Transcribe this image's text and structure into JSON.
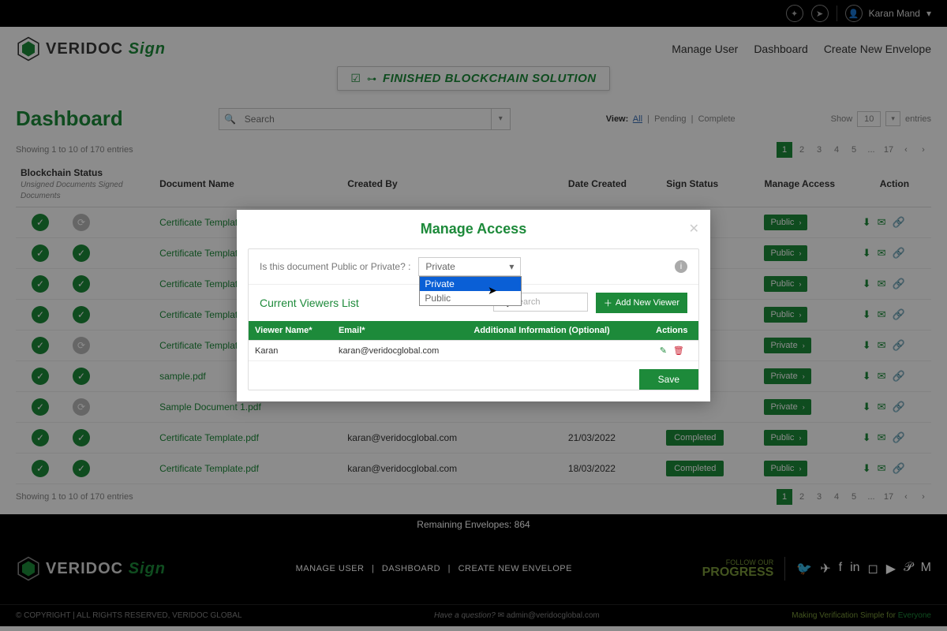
{
  "topbar": {
    "user_name": "Karan Mand"
  },
  "logo": {
    "brand": "VERIDOC",
    "product": "Sign"
  },
  "nav": {
    "manage_user": "Manage User",
    "dashboard": "Dashboard",
    "create_envelope": "Create New Envelope"
  },
  "banner": {
    "text": "FINISHED BLOCKCHAIN SOLUTION"
  },
  "dashboard": {
    "title": "Dashboard",
    "search_placeholder": "Search",
    "view_label": "View:",
    "view_all": "All",
    "view_pending": "Pending",
    "view_complete": "Complete",
    "show_label": "Show",
    "show_value": "10",
    "entries_label": "entries",
    "showing_text": "Showing 1 to 10 of 170 entries"
  },
  "pagination": {
    "pages": [
      "1",
      "2",
      "3",
      "4",
      "5",
      "...",
      "17"
    ]
  },
  "table": {
    "headers": {
      "blockchain": "Blockchain Status",
      "blockchain_sub": "Unsigned Documents Signed Documents",
      "doc": "Document Name",
      "createdby": "Created By",
      "datecreated": "Date Created",
      "signstatus": "Sign Status",
      "manageaccess": "Manage Access",
      "action": "Action"
    },
    "rows": [
      {
        "unsigned": "green",
        "signed": "gray",
        "doc": "Certificate Template.pdf",
        "by": "",
        "date": "",
        "status": "",
        "access": "Public"
      },
      {
        "unsigned": "green",
        "signed": "green",
        "doc": "Certificate Template.pdf",
        "by": "",
        "date": "",
        "status": "",
        "access": "Public"
      },
      {
        "unsigned": "green",
        "signed": "green",
        "doc": "Certificate Template.pdf",
        "by": "",
        "date": "",
        "status": "",
        "access": "Public"
      },
      {
        "unsigned": "green",
        "signed": "green",
        "doc": "Certificate Template.pdf",
        "by": "",
        "date": "",
        "status": "",
        "access": "Public"
      },
      {
        "unsigned": "green",
        "signed": "gray",
        "doc": "Certificate Template.pdf",
        "by": "",
        "date": "",
        "status": "",
        "access": "Private"
      },
      {
        "unsigned": "green",
        "signed": "green",
        "doc": "sample.pdf",
        "by": "",
        "date": "",
        "status": "",
        "access": "Private"
      },
      {
        "unsigned": "green",
        "signed": "gray",
        "doc": "Sample Document 1.pdf",
        "by": "",
        "date": "",
        "status": "",
        "access": "Private"
      },
      {
        "unsigned": "green",
        "signed": "green",
        "doc": "Certificate Template.pdf",
        "by": "karan@veridocglobal.com",
        "date": "21/03/2022",
        "status": "Completed",
        "access": "Public"
      },
      {
        "unsigned": "green",
        "signed": "green",
        "doc": "Certificate Template.pdf",
        "by": "karan@veridocglobal.com",
        "date": "18/03/2022",
        "status": "Completed",
        "access": "Public"
      }
    ]
  },
  "footer": {
    "remaining": "Remaining Envelopes: 864",
    "links": {
      "manage": "MANAGE USER",
      "dashboard": "DASHBOARD",
      "create": "CREATE NEW ENVELOPE"
    },
    "progress_small": "FOLLOW OUR",
    "progress_big": "PROGRESS",
    "copyright": "© COPYRIGHT | ALL RIGHTS RESERVED, VERIDOC GLOBAL",
    "question": "Have a question?",
    "email": "admin@veridocglobal.com",
    "tagline_a": "Making Verification Simple for ",
    "tagline_b": "Everyone"
  },
  "modal": {
    "title": "Manage Access",
    "question": "Is this document Public or Private? :",
    "selected": "Private",
    "options": [
      "Private",
      "Public"
    ],
    "viewers_title": "Current Viewers List",
    "search_placeholder": "Search",
    "add_viewer": "Add New Viewer",
    "vheaders": {
      "name": "Viewer Name*",
      "email": "Email*",
      "info": "Additional Information (Optional)",
      "actions": "Actions"
    },
    "vrows": [
      {
        "name": "Karan",
        "email": "karan@veridocglobal.com",
        "info": ""
      }
    ],
    "save": "Save"
  }
}
